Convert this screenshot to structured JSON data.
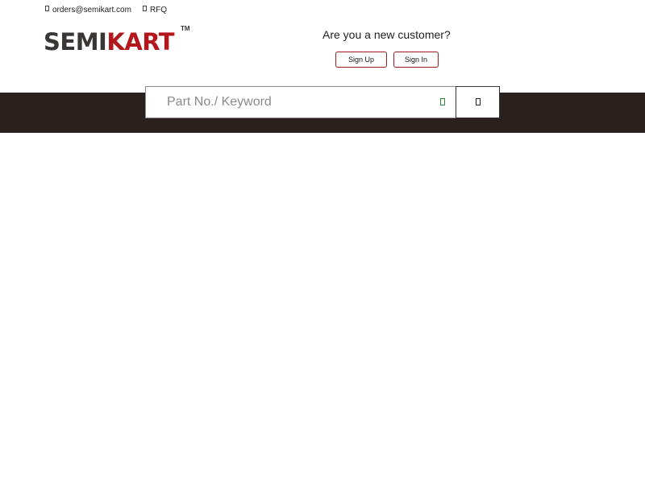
{
  "topbar": {
    "email": {
      "icon": "envelope-icon",
      "label": "orders@semikart.com"
    },
    "rfq": {
      "icon": "document-icon",
      "label": "RFQ"
    }
  },
  "logo": {
    "part1": "SEMI",
    "part2": "KART",
    "tm": "TM",
    "colors": {
      "semi": "#3a3636",
      "kart": "#b3171c"
    }
  },
  "account": {
    "prompt": "Are you a new customer?",
    "signup_label": "Sign Up",
    "signin_label": "Sign In",
    "button_border": "#9e1c1c"
  },
  "search": {
    "placeholder": "Part No./ Keyword",
    "value": "",
    "mic_icon": "microphone-icon",
    "submit_icon": "search-icon"
  },
  "navband": {
    "background": "#2a201e"
  }
}
